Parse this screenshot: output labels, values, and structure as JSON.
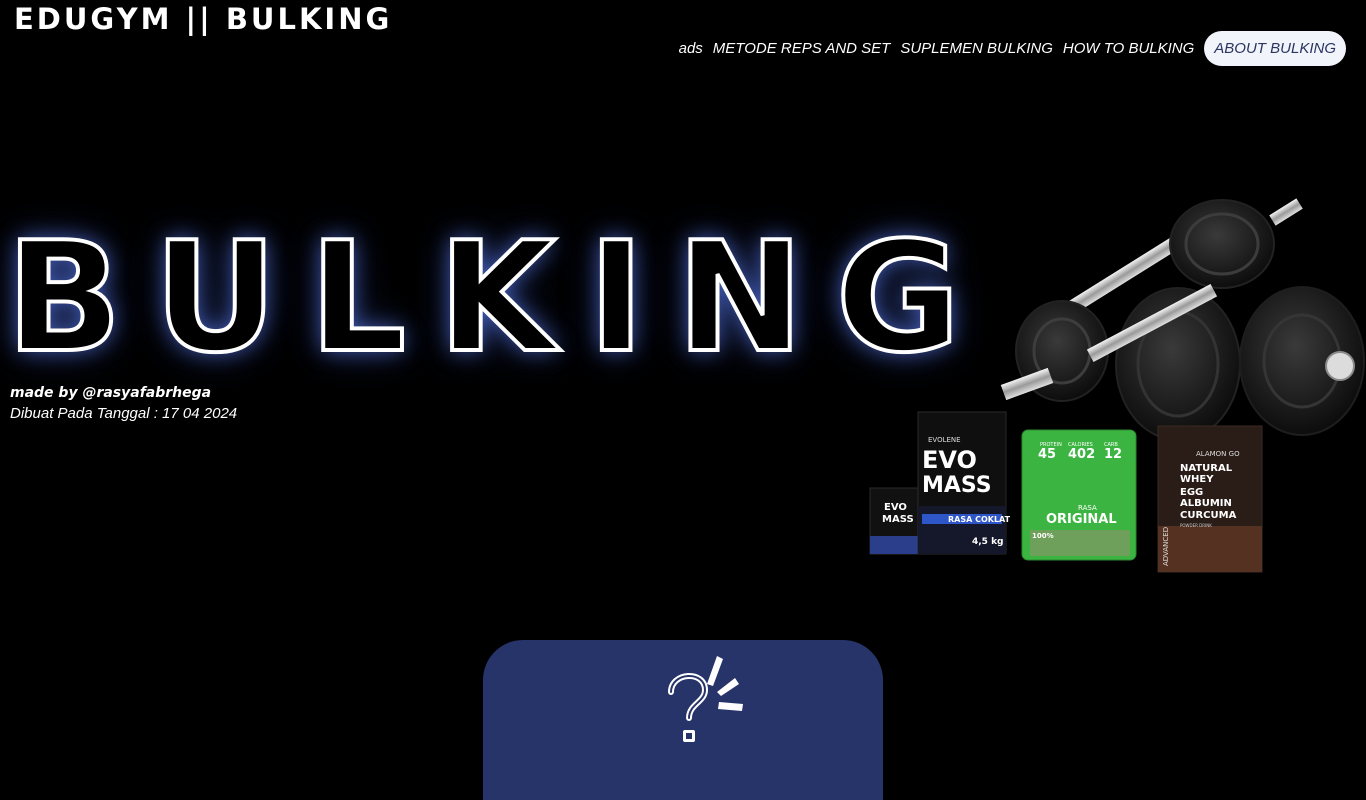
{
  "header": {
    "brand": "EDUGYM || BULKING"
  },
  "nav": {
    "items": [
      {
        "label": "ads",
        "active": false
      },
      {
        "label": "METODE REPS AND SET",
        "active": false
      },
      {
        "label": "SUPLEMEN BULKING",
        "active": false
      },
      {
        "label": "HOW TO BULKING",
        "active": false
      },
      {
        "label": "ABOUT BULKING",
        "active": true
      }
    ]
  },
  "hero": {
    "title": "BULKING",
    "credit": "made by @rasyafabrhega",
    "date_line": "Dibuat Pada Tanggal : 17 04 2024",
    "image": {
      "products": {
        "evo_small": {
          "brand": "EVO",
          "name": "MASS"
        },
        "evo_large": {
          "brand": "EVOLENE",
          "line1": "EVO",
          "line2": "MASS",
          "flavor": "RASA COKLAT",
          "weight": "4,5 kg"
        },
        "green_pack": {
          "protein_label": "PROTEIN",
          "protein": "45",
          "calories_label": "CALORIES",
          "calories": "402",
          "carb_label": "CARB",
          "carb": "12",
          "rasa": "RASA",
          "flavor": "ORIGINAL",
          "badge": "100%"
        },
        "brown_pack": {
          "brand": "ALAMON GO",
          "line1": "NATURAL",
          "line2": "WHEY",
          "line3": "EGG",
          "line4": "ALBUMIN",
          "line5": "CURCUMA",
          "sub": "POWDER DRINK",
          "side": "ADVANCED"
        }
      }
    }
  },
  "colors": {
    "background": "#000000",
    "card": "#27346a",
    "glow": "#5a78e6",
    "active_pill": "#f1f4fb"
  },
  "icons": {
    "card": "question-mark-icon"
  }
}
